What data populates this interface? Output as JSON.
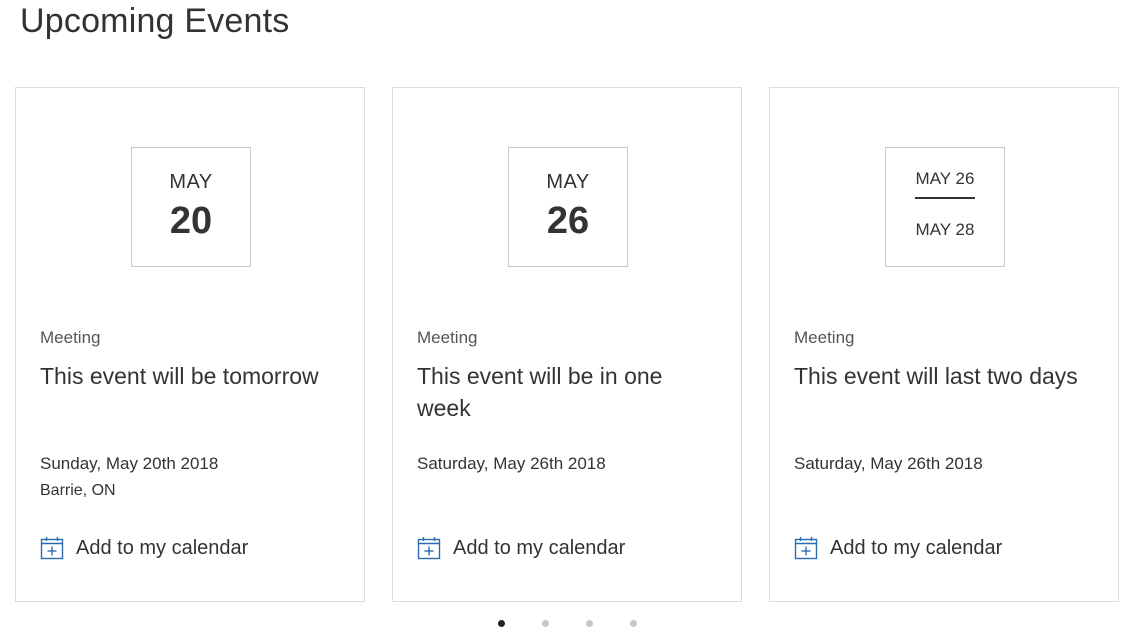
{
  "page": {
    "title": "Upcoming Events"
  },
  "events": [
    {
      "month": "MAY",
      "day": "20",
      "category": "Meeting",
      "title": "This event will be tomorrow",
      "date": "Sunday, May 20th 2018",
      "location": "Barrie, ON",
      "add_label": "Add to my calendar"
    },
    {
      "month": "MAY",
      "day": "26",
      "category": "Meeting",
      "title": "This event will be in one week",
      "date": "Saturday, May 26th 2018",
      "add_label": "Add to my calendar"
    },
    {
      "range_start": "MAY 26",
      "range_end": "MAY 28",
      "category": "Meeting",
      "title": "This event will last two days",
      "date": "Saturday, May 26th 2018",
      "add_label": "Add to my calendar"
    }
  ],
  "pagination": {
    "count": 4,
    "active": 1
  },
  "colors": {
    "icon": "#2b6cb0",
    "text": "#333333",
    "border": "#dcdcdc",
    "dot_active": "#222222",
    "dot_inactive": "#c8c8c8"
  },
  "icons": {
    "add_calendar": "calendar-add-icon"
  }
}
